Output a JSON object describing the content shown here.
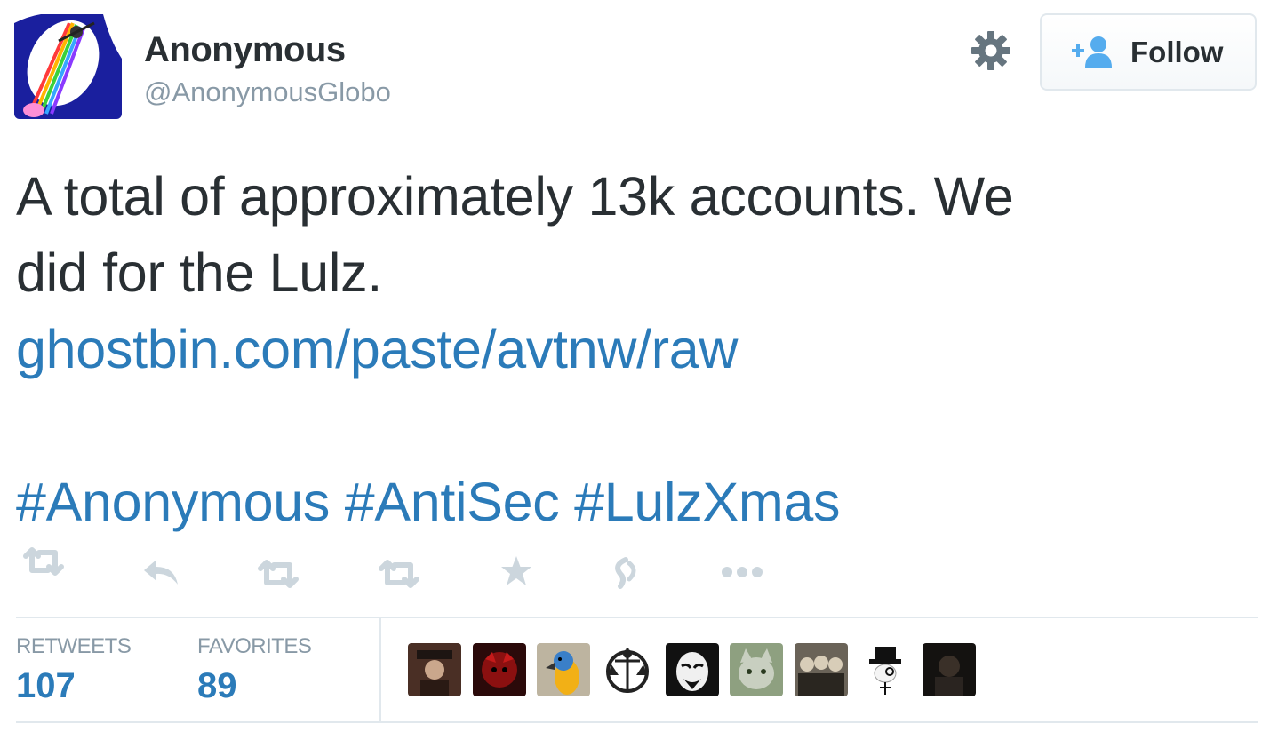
{
  "user": {
    "name": "Anonymous",
    "handle": "@AnonymousGlobo",
    "avatar_icon": "anonymous-logo-icon"
  },
  "follow_button": {
    "label": "Follow",
    "icon": "add-user-icon"
  },
  "settings_icon": "gear-icon",
  "tweet": {
    "line1": "A total of approximately 13k accounts. We",
    "line2": "did for the Lulz.",
    "link": "ghostbin.com/paste/avtnw/raw",
    "hashtags": [
      "#Anonymous",
      "#AntiSec",
      "#LulzXmas"
    ]
  },
  "actions": [
    "retweet-icon",
    "reply-icon",
    "retweet-icon",
    "retweet-icon",
    "favorite-icon",
    "vine-icon",
    "more-icon"
  ],
  "stats": {
    "retweets_label": "RETWEETS",
    "retweets_value": "107",
    "favorites_label": "FAVORITES",
    "favorites_value": "89"
  },
  "favorited_by": [
    "user-avatar-1",
    "user-avatar-2",
    "user-avatar-3",
    "user-avatar-4",
    "user-avatar-5",
    "user-avatar-6",
    "user-avatar-7",
    "user-avatar-8",
    "user-avatar-9"
  ],
  "colors": {
    "link": "#2b7bb9",
    "text": "#292f33",
    "muted": "#8899a6",
    "border": "#e1e8ed"
  }
}
